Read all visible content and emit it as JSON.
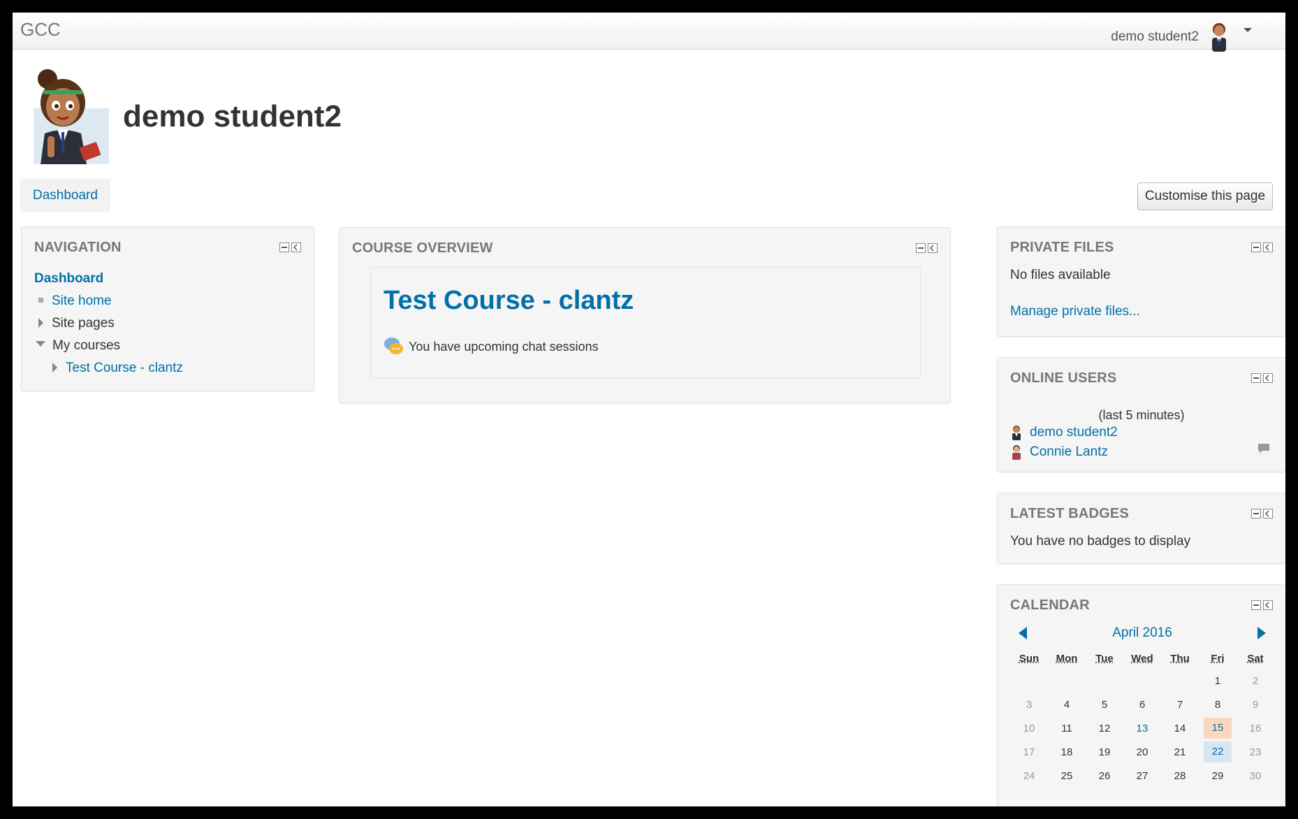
{
  "navbar": {
    "brand": "GCC",
    "user_name": "demo student2"
  },
  "header": {
    "title": "demo student2",
    "dashboard_tab": "Dashboard",
    "customise_button": "Customise this page"
  },
  "navigation": {
    "title": "NAVIGATION",
    "dashboard": "Dashboard",
    "site_home": "Site home",
    "site_pages": "Site pages",
    "my_courses": "My courses",
    "course": "Test Course - clantz"
  },
  "course_overview": {
    "title": "COURSE OVERVIEW",
    "course_name": "Test Course - clantz",
    "notice": "You have upcoming chat sessions"
  },
  "private_files": {
    "title": "PRIVATE FILES",
    "status": "No files available",
    "manage_link": "Manage private files..."
  },
  "online_users": {
    "title": "ONLINE USERS",
    "subtitle": "(last 5 minutes)",
    "users": [
      "demo student2",
      "Connie Lantz"
    ]
  },
  "latest_badges": {
    "title": "LATEST BADGES",
    "status": "You have no badges to display"
  },
  "calendar": {
    "title": "CALENDAR",
    "month": "April 2016",
    "weekdays": [
      "Sun",
      "Mon",
      "Tue",
      "Wed",
      "Thu",
      "Fri",
      "Sat"
    ],
    "weeks": [
      [
        "",
        "",
        "",
        "",
        "",
        "1",
        "2"
      ],
      [
        "3",
        "4",
        "5",
        "6",
        "7",
        "8",
        "9"
      ],
      [
        "10",
        "11",
        "12",
        "13",
        "14",
        "15",
        "16"
      ],
      [
        "17",
        "18",
        "19",
        "20",
        "21",
        "22",
        "23"
      ],
      [
        "24",
        "25",
        "26",
        "27",
        "28",
        "29",
        "30"
      ]
    ]
  },
  "colors": {
    "link": "#0070a8",
    "today_highlight": "#fbd7c0",
    "event_highlight": "#d6e6f0",
    "block_background": "#f5f5f5"
  }
}
